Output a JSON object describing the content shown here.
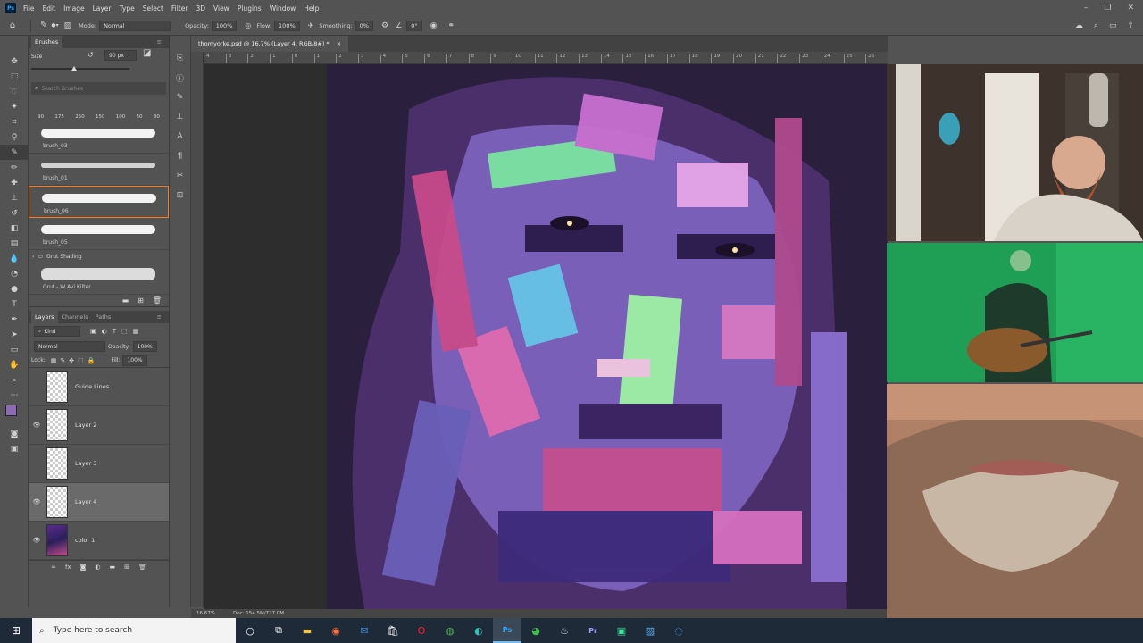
{
  "menubar": {
    "app_icon": "Ps",
    "items": [
      "File",
      "Edit",
      "Image",
      "Layer",
      "Type",
      "Select",
      "Filter",
      "3D",
      "View",
      "Plugins",
      "Window",
      "Help"
    ]
  },
  "options": {
    "mode_label": "Mode:",
    "mode_value": "Normal",
    "opacity_label": "Opacity:",
    "opacity_value": "100%",
    "flow_label": "Flow:",
    "flow_value": "100%",
    "smoothing_label": "Smoothing:",
    "smoothing_value": "0%",
    "angle_value": "0°"
  },
  "brushes": {
    "tab": "Brushes",
    "size_label": "Size",
    "size_value": "90 px",
    "search_placeholder": "Search Brushes",
    "presets": [
      "90",
      "175",
      "250",
      "150",
      "100",
      "50",
      "80"
    ],
    "items": [
      {
        "name": "brush_03"
      },
      {
        "name": "brush_01"
      },
      {
        "name": "brush_06"
      },
      {
        "name": "brush_05"
      }
    ],
    "group_name": "Grut Shading",
    "group_item": "Grut - W Avi Kilter"
  },
  "layers": {
    "tabs": [
      "Layers",
      "Channels",
      "Paths"
    ],
    "kind_label": "Kind",
    "blend_mode": "Normal",
    "opacity_label": "Opacity:",
    "opacity_value": "100%",
    "lock_label": "Lock:",
    "fill_label": "Fill:",
    "fill_value": "100%",
    "items": [
      {
        "name": "Guide Lines",
        "visible": false
      },
      {
        "name": "Layer 2",
        "visible": true
      },
      {
        "name": "Layer 3",
        "visible": false
      },
      {
        "name": "Layer 4",
        "visible": true,
        "selected": true
      },
      {
        "name": "color 1",
        "visible": true
      }
    ]
  },
  "document": {
    "tab_title": "thomyorke.psd @ 16.7% (Layer 4, RGB/8#) *",
    "zoom": "16.67%",
    "doc_info": "Doc: 154.5M/727.0M",
    "ruler_ticks": [
      "4",
      "3",
      "2",
      "1",
      "0",
      "1",
      "2",
      "3",
      "4",
      "5",
      "6",
      "7",
      "8",
      "9",
      "10",
      "11",
      "12",
      "13",
      "14",
      "15",
      "16",
      "17",
      "18",
      "19",
      "20",
      "21",
      "22",
      "23",
      "24",
      "25",
      "26"
    ]
  },
  "taskbar": {
    "search_placeholder": "Type here to search",
    "apps": [
      "task-view",
      "file-explorer",
      "firefox",
      "mail",
      "store",
      "opera",
      "chrome",
      "edge",
      "photoshop",
      "app-green",
      "steam",
      "premiere",
      "app-teal",
      "photos",
      "app-blue"
    ]
  },
  "colors": {
    "foreground": "#8b6bb5",
    "background": "#ffffff",
    "accent_selection": "#ff7a1a"
  }
}
